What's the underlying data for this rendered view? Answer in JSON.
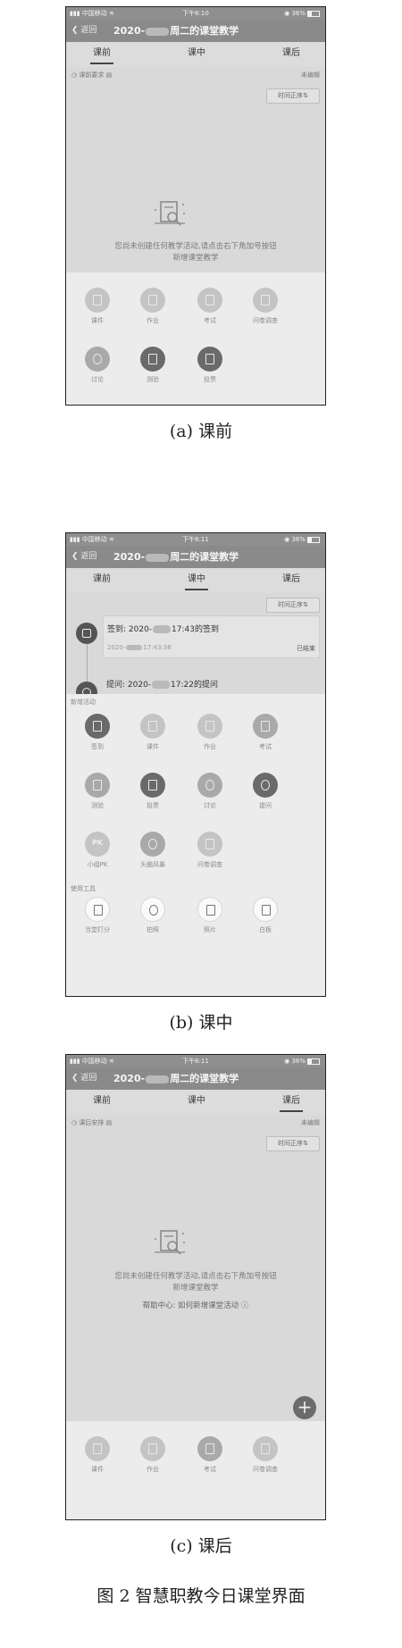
{
  "screens": [
    {
      "status": {
        "carrier": "中国移动",
        "time": "下午6:10",
        "battery": "36%"
      },
      "nav": {
        "back": "返回",
        "title_prefix": "2020-",
        "title_suffix": "周二的课堂教学"
      },
      "tabs": [
        "课前",
        "课中",
        "课后"
      ],
      "active_tab": "课前",
      "subheader": {
        "label": "课前要求",
        "status": "未编辑"
      },
      "sort_label": "时间正序",
      "empty_line1": "您尚未创建任何教学活动,请点击右下角加号按钮",
      "empty_line2": "新增课堂教学",
      "actions": [
        {
          "label": "课件",
          "icon": "courseware-icon"
        },
        {
          "label": "作业",
          "icon": "homework-icon"
        },
        {
          "label": "考试",
          "icon": "exam-icon"
        },
        {
          "label": "问卷调查",
          "icon": "survey-icon"
        },
        {
          "label": "讨论",
          "icon": "discussion-icon"
        },
        {
          "label": "测验",
          "icon": "quiz-icon"
        },
        {
          "label": "投票",
          "icon": "vote-icon"
        }
      ],
      "caption": "(a) 课前"
    },
    {
      "status": {
        "carrier": "中国移动",
        "time": "下午6:11",
        "battery": "36%"
      },
      "nav": {
        "back": "返回",
        "title_prefix": "2020-",
        "title_suffix": "周二的课堂教学"
      },
      "tabs": [
        "课前",
        "课中",
        "课后"
      ],
      "active_tab": "课中",
      "sort_label": "时间正序",
      "timeline": [
        {
          "title_prefix": "签到: 2020-",
          "title_suffix": "17:43的签到",
          "time_prefix": "2020-",
          "time_suffix": "17:43:36",
          "state": "已结束",
          "icon": "checkin-icon"
        },
        {
          "title_prefix": "提问: 2020-",
          "title_suffix": "17:22的提问",
          "icon": "question-icon"
        }
      ],
      "new_activity_label": "新增活动",
      "actions": [
        {
          "label": "签到",
          "icon": "checkin-icon"
        },
        {
          "label": "课件",
          "icon": "courseware-icon"
        },
        {
          "label": "作业",
          "icon": "homework-icon"
        },
        {
          "label": "考试",
          "icon": "exam-icon"
        },
        {
          "label": "测验",
          "icon": "quiz-icon"
        },
        {
          "label": "投票",
          "icon": "vote-icon"
        },
        {
          "label": "讨论",
          "icon": "discussion-icon"
        },
        {
          "label": "提问",
          "icon": "question-icon"
        },
        {
          "label": "小组PK",
          "icon": "group-pk-icon",
          "badge": "PK"
        },
        {
          "label": "头脑风暴",
          "icon": "brainstorm-icon"
        },
        {
          "label": "问卷调查",
          "icon": "survey-icon"
        }
      ],
      "tools_label": "使用工具",
      "tools": [
        {
          "label": "当堂打分",
          "icon": "score-icon"
        },
        {
          "label": "拍照",
          "icon": "camera-icon"
        },
        {
          "label": "照片",
          "icon": "photo-icon"
        },
        {
          "label": "白板",
          "icon": "whiteboard-icon"
        }
      ],
      "caption": "(b) 课中"
    },
    {
      "status": {
        "carrier": "中国移动",
        "time": "下午6:11",
        "battery": "36%"
      },
      "nav": {
        "back": "返回",
        "title_prefix": "2020-",
        "title_suffix": "周二的课堂教学"
      },
      "tabs": [
        "课前",
        "课中",
        "课后"
      ],
      "active_tab": "课后",
      "subheader": {
        "label": "课后安排",
        "status": "未编辑"
      },
      "sort_label": "时间正序",
      "empty_line1": "您尚未创建任何教学活动,请点击右下角加号按钮",
      "empty_line2": "新增课堂教学",
      "help_text": "帮助中心: 如何新增课堂活动",
      "actions": [
        {
          "label": "课件",
          "icon": "courseware-icon"
        },
        {
          "label": "作业",
          "icon": "homework-icon"
        },
        {
          "label": "考试",
          "icon": "exam-icon"
        },
        {
          "label": "问卷调查",
          "icon": "survey-icon"
        }
      ],
      "caption": "(c) 课后"
    }
  ],
  "figure_caption": "图 2   智慧职教今日课堂界面"
}
